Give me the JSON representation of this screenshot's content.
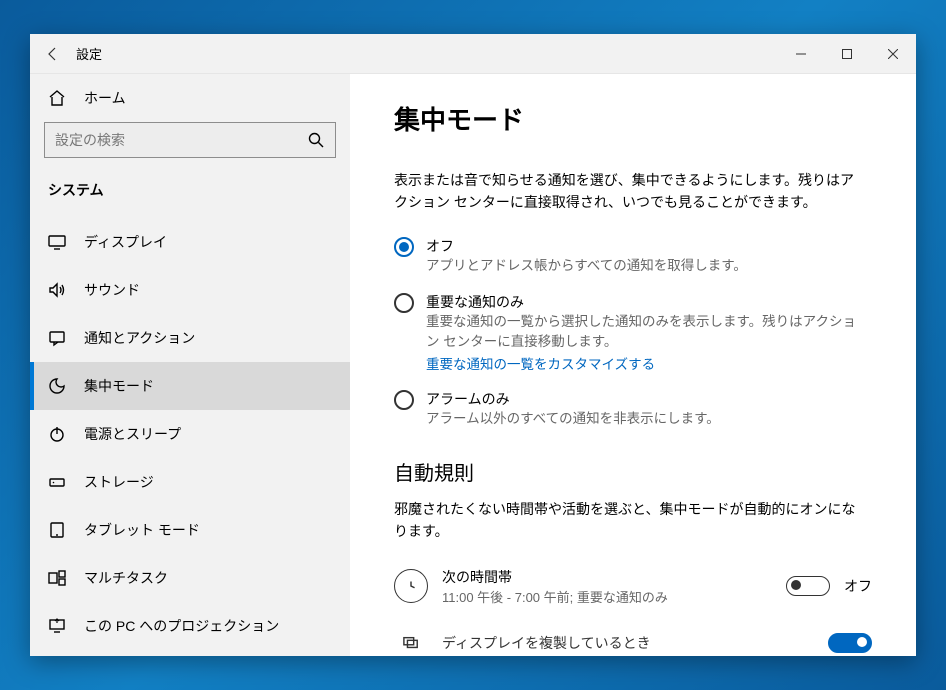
{
  "titlebar": {
    "title": "設定"
  },
  "sidebar": {
    "home": "ホーム",
    "search_placeholder": "設定の検索",
    "category": "システム",
    "items": [
      {
        "label": "ディスプレイ"
      },
      {
        "label": "サウンド"
      },
      {
        "label": "通知とアクション"
      },
      {
        "label": "集中モード"
      },
      {
        "label": "電源とスリープ"
      },
      {
        "label": "ストレージ"
      },
      {
        "label": "タブレット モード"
      },
      {
        "label": "マルチタスク"
      },
      {
        "label": "この PC へのプロジェクション"
      }
    ]
  },
  "main": {
    "title": "集中モード",
    "lead": "表示または音で知らせる通知を選び、集中できるようにします。残りはアクション センターに直接取得され、いつでも見ることができます。",
    "radios": [
      {
        "label": "オフ",
        "desc": "アプリとアドレス帳からすべての通知を取得します。",
        "checked": true
      },
      {
        "label": "重要な通知のみ",
        "desc": "重要な通知の一覧から選択した通知のみを表示します。残りはアクション センターに直接移動します。",
        "link": "重要な通知の一覧をカスタマイズする",
        "checked": false
      },
      {
        "label": "アラームのみ",
        "desc": "アラーム以外のすべての通知を非表示にします。",
        "checked": false
      }
    ],
    "auto": {
      "heading": "自動規則",
      "sub": "邪魔されたくない時間帯や活動を選ぶと、集中モードが自動的にオンになります。",
      "rules": [
        {
          "title": "次の時間帯",
          "sub": "11:00 午後 - 7:00 午前; 重要な通知のみ",
          "toggle_on": false,
          "toggle_label": "オフ"
        },
        {
          "title": "ディスプレイを複製しているとき",
          "toggle_on": true
        }
      ]
    }
  }
}
